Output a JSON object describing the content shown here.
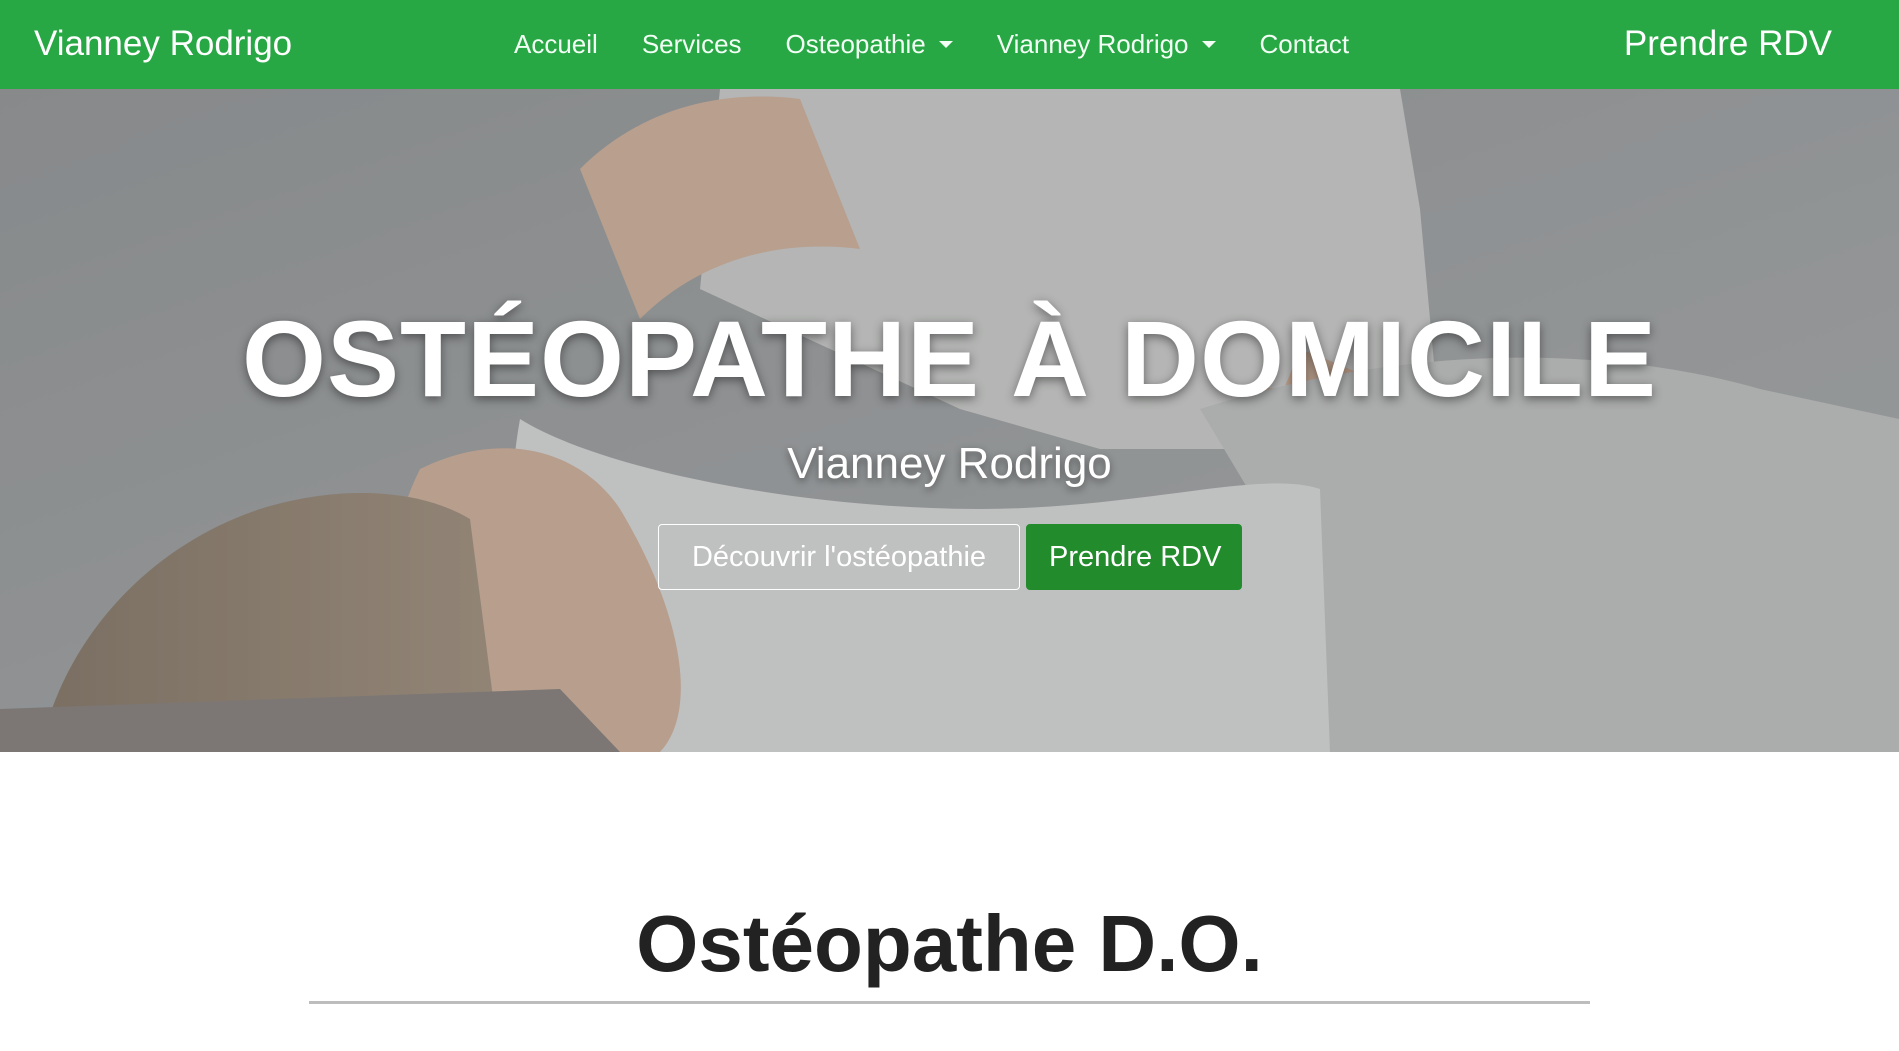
{
  "navbar": {
    "brand": "Vianney Rodrigo",
    "links": [
      {
        "label": "Accueil",
        "dropdown": false
      },
      {
        "label": "Services",
        "dropdown": false
      },
      {
        "label": "Osteopathie",
        "dropdown": true
      },
      {
        "label": "Vianney Rodrigo",
        "dropdown": true
      },
      {
        "label": "Contact",
        "dropdown": false
      }
    ],
    "cta": "Prendre RDV"
  },
  "hero": {
    "title": "OSTÉOPATHE À DOMICILE",
    "subtitle": "Vianney Rodrigo",
    "buttons": {
      "discover": "Découvrir l'ostéopathie",
      "appointment": "Prendre RDV"
    }
  },
  "section": {
    "title": "Ostéopathe D.O."
  },
  "colors": {
    "navbar": "#28a745",
    "primary_button": "#228b2c",
    "heading_text": "#222222",
    "divider": "#bdbdbd"
  },
  "icons": {
    "dropdown": "caret-down-icon"
  }
}
